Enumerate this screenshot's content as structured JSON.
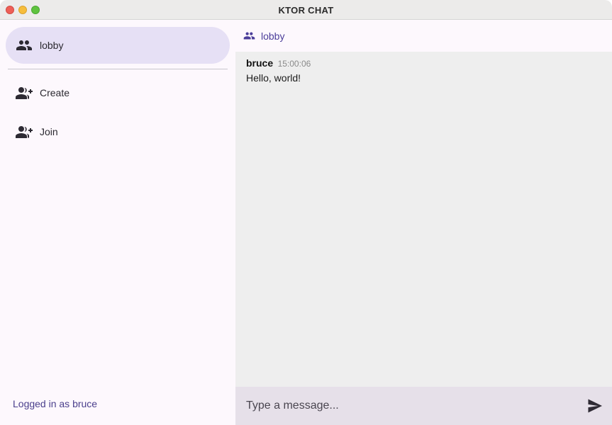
{
  "window": {
    "title": "KTOR CHAT"
  },
  "sidebar": {
    "items": [
      {
        "label": "lobby",
        "icon": "group-icon",
        "active": true
      },
      {
        "label": "Create",
        "icon": "group-add-icon",
        "active": false
      },
      {
        "label": "Join",
        "icon": "group-add-icon",
        "active": false
      }
    ],
    "footer": "Logged in as bruce"
  },
  "channel": {
    "name": "lobby",
    "icon": "group-icon",
    "accent": "#4b3e9a"
  },
  "messages": [
    {
      "author": "bruce",
      "time": "15:00:06",
      "text": "Hello, world!"
    }
  ],
  "composer": {
    "placeholder": "Type a message...",
    "value": "",
    "send_icon": "send-icon"
  },
  "colors": {
    "active_item_bg": "#e6e0f5",
    "composer_bg": "#e6e0e9",
    "messages_bg": "#eeeeee",
    "link": "#4a3f8c"
  }
}
